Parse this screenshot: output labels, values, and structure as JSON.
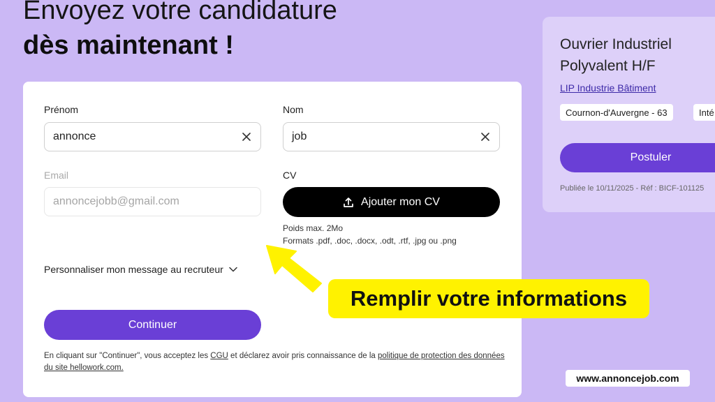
{
  "headline": {
    "line1": "Envoyez votre candidature",
    "line2": "dès maintenant !"
  },
  "form": {
    "first_name": {
      "label": "Prénom",
      "value": "annonce"
    },
    "last_name": {
      "label": "Nom",
      "value": "job"
    },
    "email": {
      "label": "Email",
      "placeholder": "annoncejobb@gmail.com"
    },
    "cv": {
      "label": "CV",
      "button_label": "Ajouter mon CV",
      "hint_size": "Poids max. 2Mo",
      "hint_formats": "Formats .pdf, .doc, .docx, .odt, .rtf, .jpg ou .png"
    },
    "personalize_label": "Personnaliser mon message au recruteur",
    "continue_label": "Continuer",
    "legal": {
      "part1": "En cliquant sur \"Continuer\", vous acceptez les ",
      "cgu_link": "CGU",
      "part2": " et déclarez avoir pris connaissance de la ",
      "policy_link": "politique de protection des données du site hellowork.com."
    }
  },
  "job": {
    "title": "Ouvrier Industriel Polyvalent H/F",
    "company": "LIP Industrie Bâtiment",
    "tags": [
      "Cournon-d'Auvergne - 63",
      "Inté"
    ],
    "apply_label": "Postuler",
    "published": "Publiée le 10/11/2025 - Réf : BICF-101125"
  },
  "callout": "Remplir votre informations",
  "watermark": "www.annoncejob.com",
  "colors": {
    "background": "#cbb8f5",
    "primary": "#6a3fd6",
    "callout": "#fff200"
  },
  "icons": [
    "clear-icon",
    "upload-icon",
    "chevron-down-icon",
    "arrow-pointer-icon"
  ]
}
